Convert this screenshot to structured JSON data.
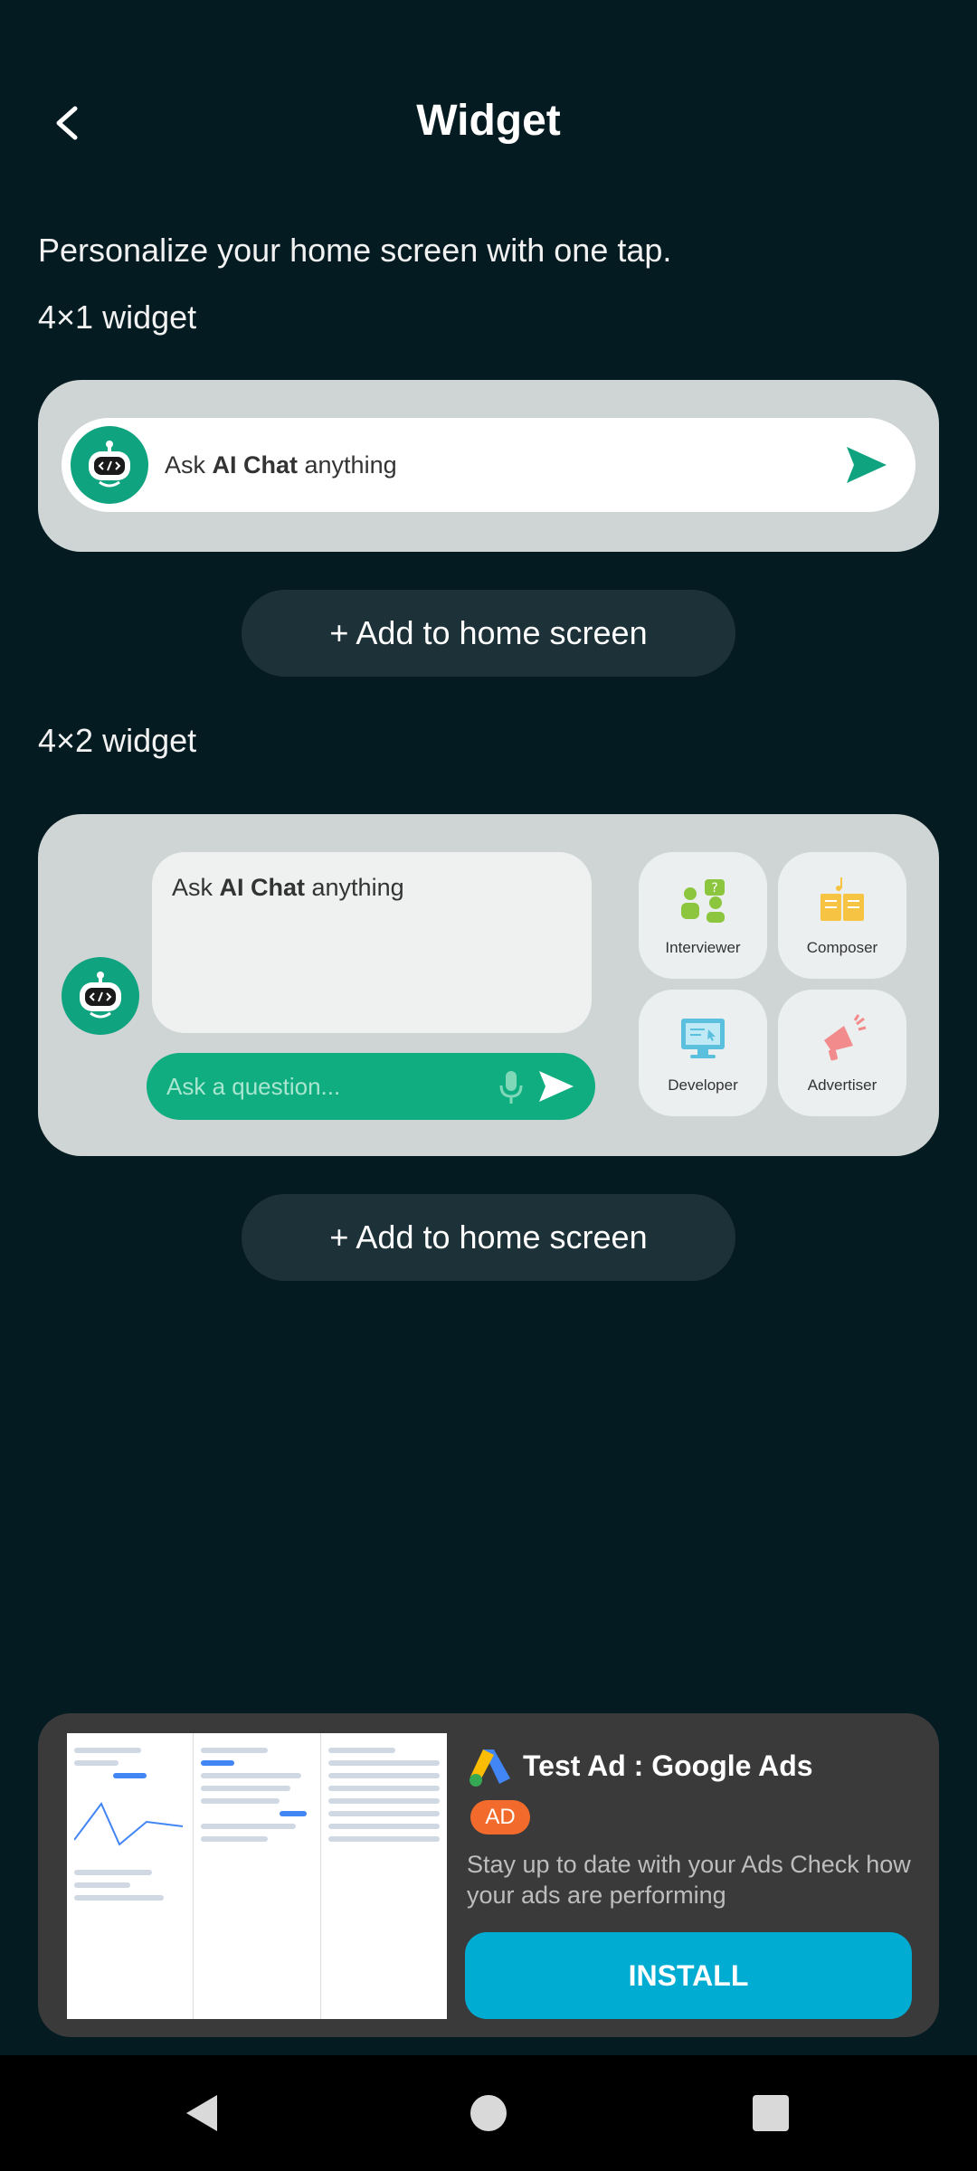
{
  "header": {
    "title": "Widget"
  },
  "subtitle": "Personalize your home screen with one tap.",
  "widget_4x1": {
    "label": "4×1 widget",
    "prompt_prefix": "Ask ",
    "prompt_brand": "AI Chat",
    "prompt_suffix": " anything",
    "add_button": "+ Add to home screen"
  },
  "widget_4x2": {
    "label": "4×2 widget",
    "prompt_prefix": "Ask ",
    "prompt_brand": "AI Chat",
    "prompt_suffix": " anything",
    "ask_placeholder": "Ask a question...",
    "tiles": [
      {
        "label": "Interviewer",
        "icon": "interviewer-icon"
      },
      {
        "label": "Composer",
        "icon": "composer-icon"
      },
      {
        "label": "Developer",
        "icon": "developer-icon"
      },
      {
        "label": "Advertiser",
        "icon": "advertiser-icon"
      }
    ],
    "add_button": "+ Add to home screen"
  },
  "ad": {
    "title": "Test Ad : Google Ads",
    "badge": "AD",
    "description": "Stay up to date with your Ads Check how your ads are performing",
    "install": "INSTALL"
  },
  "colors": {
    "background": "#041b22",
    "accent_green": "#10a37f",
    "install_blue": "#01acd3",
    "ad_badge": "#f26b2d"
  }
}
